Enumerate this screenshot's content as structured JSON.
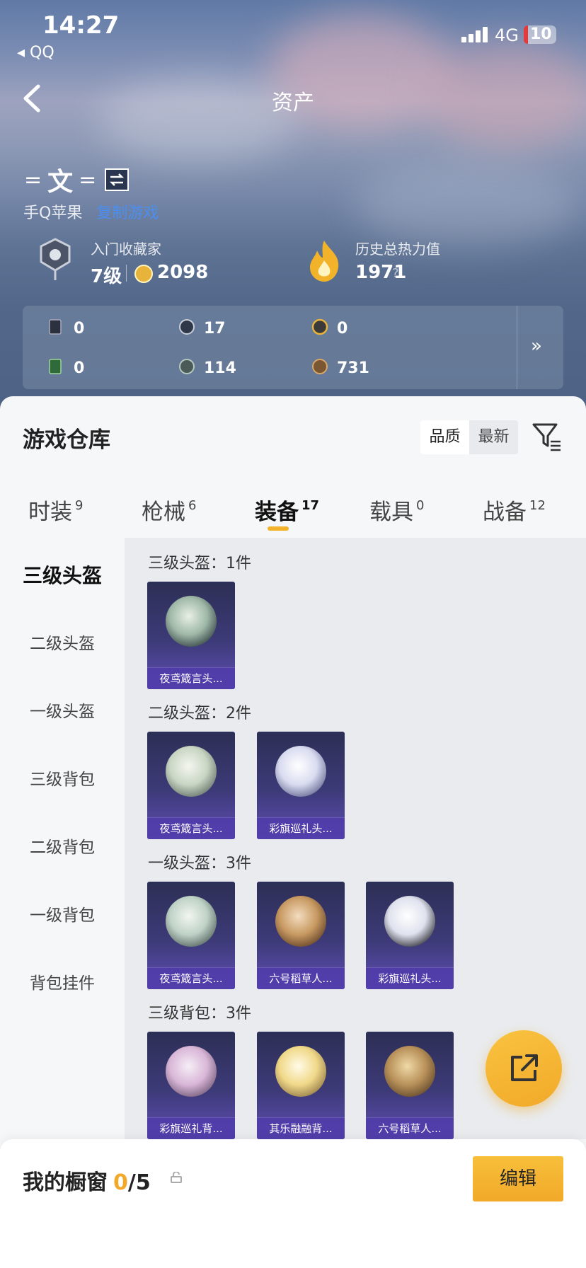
{
  "status_bar": {
    "time": "14:27",
    "back_app": "QQ",
    "network": "4G",
    "battery": "10"
  },
  "header": {
    "title": "资产"
  },
  "profile": {
    "name_decor_left": "=",
    "name": "文",
    "name_decor_right": "=",
    "platform": "手Q苹果",
    "link": "复制游戏",
    "collector_title": "入门收藏家",
    "collector_level": "7级",
    "coin_count": "2098",
    "heat_label": "历史总热力值",
    "heat_value": "1971",
    "heat_help": "?"
  },
  "resources": [
    {
      "icon": "card-icon",
      "value": "0"
    },
    {
      "icon": "token-icon",
      "value": "17"
    },
    {
      "icon": "gold-token-icon",
      "value": "0"
    },
    {
      "icon": "green-card-icon",
      "value": "0"
    },
    {
      "icon": "orb-icon",
      "value": "114"
    },
    {
      "icon": "bronze-coin-icon",
      "value": "731"
    }
  ],
  "warehouse": {
    "title": "游戏仓库",
    "sort_options": [
      "品质",
      "最新"
    ],
    "tabs": [
      {
        "label": "时装",
        "count": "9"
      },
      {
        "label": "枪械",
        "count": "6"
      },
      {
        "label": "装备",
        "count": "17",
        "active": true
      },
      {
        "label": "载具",
        "count": "0"
      },
      {
        "label": "战备",
        "count": "12"
      }
    ]
  },
  "categories": [
    "三级头盔",
    "二级头盔",
    "一级头盔",
    "三级背包",
    "二级背包",
    "一级背包",
    "背包挂件"
  ],
  "groups": [
    {
      "title": "三级头盔：1件",
      "items": [
        "夜鸢箴言头..."
      ]
    },
    {
      "title": "二级头盔：2件",
      "items": [
        "夜鸢箴言头...",
        "彩旗巡礼头..."
      ]
    },
    {
      "title": "一级头盔：3件",
      "items": [
        "夜鸢箴言头...",
        "六号稻草人...",
        "彩旗巡礼头..."
      ]
    },
    {
      "title": "三级背包：3件",
      "items": [
        "彩旗巡礼背...",
        "其乐融融背...",
        "六号稻草人..."
      ]
    }
  ],
  "showcase": {
    "title": "我的橱窗",
    "current": "0",
    "total": "/5",
    "edit_label": "编辑"
  },
  "colors": {
    "accent": "#f2b32b",
    "card_bg": "#3d3a78"
  }
}
